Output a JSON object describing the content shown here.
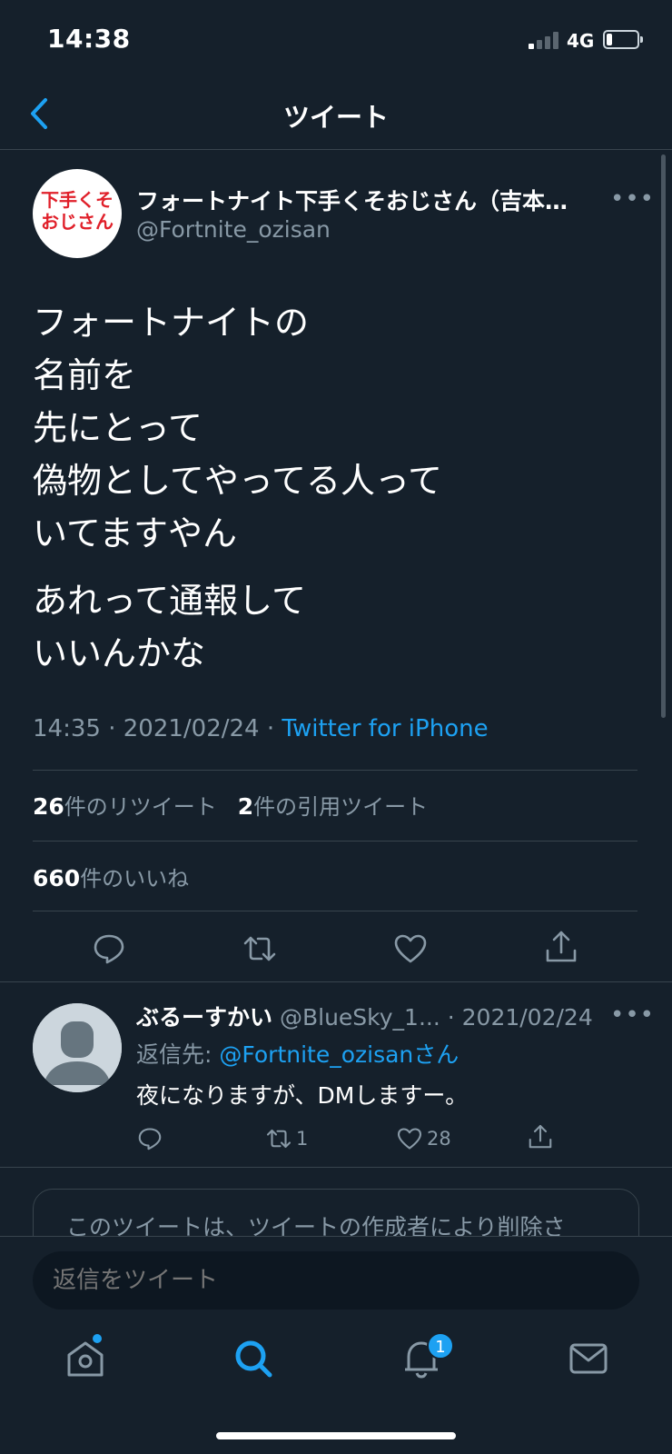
{
  "status_bar": {
    "time": "14:38",
    "network": "4G",
    "battery_level": 0.2
  },
  "nav": {
    "title": "ツイート"
  },
  "tweet": {
    "avatar_text": [
      "下手くそ",
      "おじさん"
    ],
    "display_name": "フォートナイト下手くそおじさん（吉本…",
    "handle": "@Fortnite_ozisan",
    "lines_a": [
      "フォートナイトの",
      "名前を",
      "先にとって",
      "偽物としてやってる人って",
      "いてますやん"
    ],
    "lines_b": [
      "あれって通報して",
      "いいんかな"
    ],
    "time": "14:35",
    "date": "2021/02/24",
    "source": "Twitter for iPhone",
    "retweets_count": "26",
    "retweets_label": "件のリツイート",
    "quotes_count": "2",
    "quotes_label": "件の引用ツイート",
    "likes_count": "660",
    "likes_label": "件のいいね"
  },
  "reply": {
    "display_name": "ぶるーすかい",
    "handle": "@BlueSky_1...",
    "date": "2021/02/24",
    "reply_to_prefix": "返信先: ",
    "reply_to_handle": "@Fortnite_ozisanさん",
    "text": "夜になりますが、DMしますー。",
    "retweets": "1",
    "likes": "28"
  },
  "deleted_notice": "このツイートは、ツイートの作成者により削除さ",
  "composer": {
    "placeholder": "返信をツイート"
  },
  "tabbar": {
    "notification_badge": "1"
  },
  "colors": {
    "background": "#15202b",
    "accent": "#1da1f2",
    "muted": "#8899a6",
    "border": "#38444d"
  }
}
